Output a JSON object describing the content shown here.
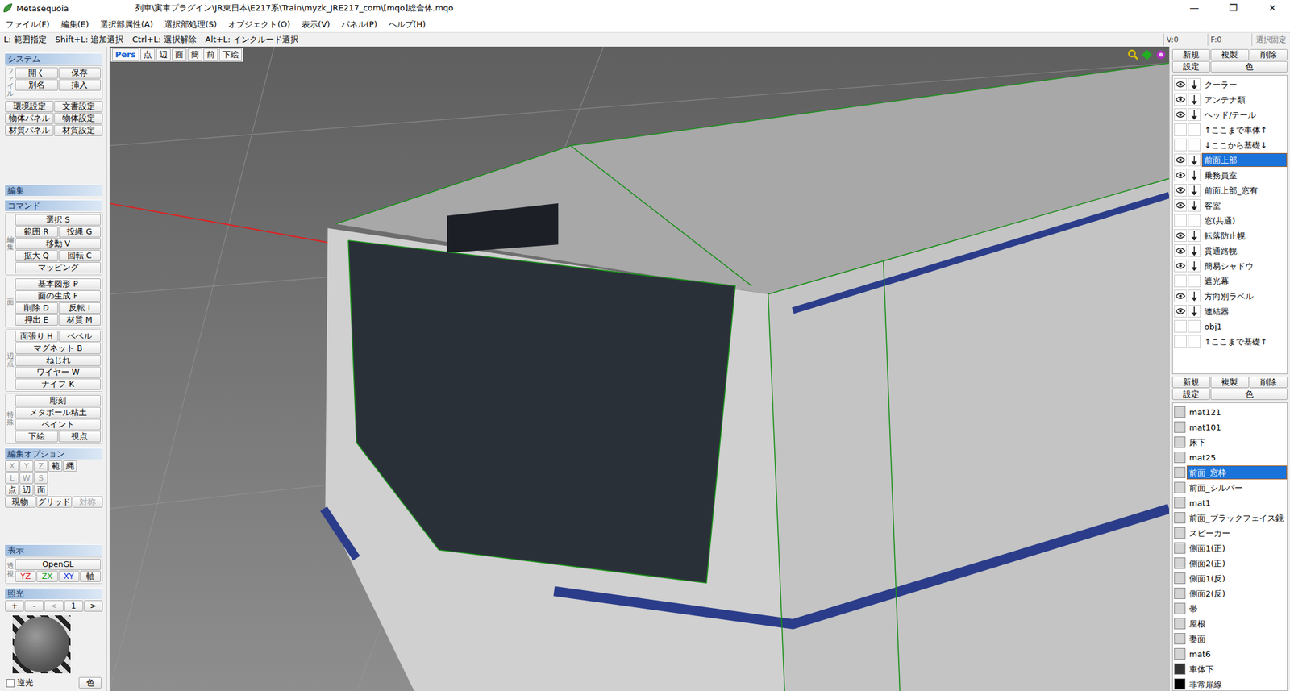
{
  "window": {
    "app": "Metasequoia",
    "path": "列車\\実車プラグイン\\JR東日本\\E217系\\Train\\myzk_JRE217_com\\[mqo]総合体.mqo",
    "controls": [
      "—",
      "❐",
      "✕"
    ]
  },
  "menu": [
    "ファイル(F)",
    "編集(E)",
    "選択部属性(A)",
    "選択部処理(S)",
    "オブジェクト(O)",
    "表示(V)",
    "パネル(P)",
    "ヘルプ(H)"
  ],
  "hint_bar": {
    "hints": [
      "L: 範囲指定",
      "Shift+L: 追加選択",
      "Ctrl+L: 選択解除",
      "Alt+L: インクルード選択"
    ],
    "counters": [
      "V:0",
      "F:0"
    ],
    "lock_button": "選択固定"
  },
  "left_panel": {
    "system": {
      "header": "システム",
      "group_label": "ファイル",
      "file_rows": [
        [
          "開く",
          "保存"
        ],
        [
          "別名",
          "挿入"
        ]
      ],
      "rows": [
        [
          "環境設定",
          "文書設定"
        ],
        [
          "物体パネル",
          "物体設定"
        ],
        [
          "材質パネル",
          "材質設定"
        ]
      ]
    },
    "edit_header": "編集",
    "command": {
      "header": "コマンド",
      "groups": [
        {
          "label": "編集",
          "rows": [
            [
              "選択 S"
            ],
            [
              "範囲 R",
              "投縄 G"
            ],
            [
              "移動 V"
            ],
            [
              "拡大 Q",
              "回転 C"
            ],
            [
              "マッピング"
            ]
          ]
        },
        {
          "label": "面",
          "rows": [
            [
              "基本図形 P"
            ],
            [
              "面の生成 F"
            ],
            [
              "削除 D",
              "反転 I"
            ],
            [
              "押出 E",
              "材質 M"
            ]
          ]
        },
        {
          "label": "辺・点",
          "rows": [
            [
              "面張り H",
              "ベベル"
            ],
            [
              "マグネット B"
            ],
            [
              "ねじれ"
            ],
            [
              "ワイヤー W"
            ],
            [
              "ナイフ K"
            ]
          ]
        },
        {
          "label": "特殊",
          "rows": [
            [
              "彫刻"
            ],
            [
              "メタボール粘土"
            ],
            [
              "ペイント"
            ],
            [
              "下絵",
              "視点"
            ]
          ]
        }
      ]
    },
    "edit_options": {
      "header": "編集オプション",
      "rows": [
        [
          {
            "label": "X",
            "enabled": false
          },
          {
            "label": "Y",
            "enabled": false
          },
          {
            "label": "Z",
            "enabled": false
          },
          {
            "label": "範",
            "enabled": true
          },
          {
            "label": "縄",
            "enabled": true
          }
        ],
        [
          {
            "label": "L",
            "enabled": false
          },
          {
            "label": "W",
            "enabled": false
          },
          {
            "label": "S",
            "enabled": false
          }
        ],
        [
          {
            "label": "点",
            "enabled": true
          },
          {
            "label": "辺",
            "enabled": true
          },
          {
            "label": "面",
            "enabled": true
          }
        ],
        [
          {
            "label": "現物",
            "enabled": true
          },
          {
            "label": "グリッド",
            "enabled": true
          },
          {
            "label": "対称",
            "enabled": false
          }
        ]
      ]
    },
    "display": {
      "header": "表示",
      "group_label": "透視",
      "render_button": "OpenGL",
      "axes": [
        {
          "label": "YZ",
          "color": "#e01010"
        },
        {
          "label": "ZX",
          "color": "#10a010"
        },
        {
          "label": "XY",
          "color": "#1030e0"
        },
        {
          "label": "軸",
          "color": "#000000"
        }
      ]
    },
    "lighting": {
      "header": "照光",
      "controls": [
        {
          "label": "+",
          "enabled": true
        },
        {
          "label": "-",
          "enabled": true
        },
        {
          "label": "<",
          "enabled": false
        },
        {
          "label": "1",
          "enabled": true
        },
        {
          "label": ">",
          "enabled": true
        }
      ],
      "backlight": {
        "label": "逆光",
        "checked": false
      },
      "color_button": "色"
    }
  },
  "viewport": {
    "toolbar": [
      {
        "label": "Pers",
        "selected": true
      },
      {
        "label": "点",
        "selected": false
      },
      {
        "label": "辺",
        "selected": false
      },
      {
        "label": "面",
        "selected": false
      },
      {
        "label": "簡",
        "selected": false
      },
      {
        "label": "前",
        "selected": false
      },
      {
        "label": "下絵",
        "selected": false
      }
    ]
  },
  "object_panel": {
    "buttons": [
      "新規",
      "複製",
      "削除"
    ],
    "buttons2": [
      "設定",
      "色"
    ],
    "items": [
      {
        "name": "クーラー",
        "visible": true,
        "editable": true,
        "selected": false
      },
      {
        "name": "アンテナ類",
        "visible": true,
        "editable": true,
        "selected": false
      },
      {
        "name": "ヘッド/テール",
        "visible": true,
        "editable": true,
        "selected": false
      },
      {
        "name": "↑ここまで車体↑",
        "visible": false,
        "editable": false,
        "selected": false
      },
      {
        "name": "↓ここから基礎↓",
        "visible": false,
        "editable": false,
        "selected": false
      },
      {
        "name": "前面上部",
        "visible": true,
        "editable": true,
        "selected": true
      },
      {
        "name": "乗務員室",
        "visible": true,
        "editable": true,
        "selected": false
      },
      {
        "name": "前面上部_窓有",
        "visible": true,
        "editable": true,
        "selected": false
      },
      {
        "name": "客室",
        "visible": true,
        "editable": true,
        "selected": false
      },
      {
        "name": "窓(共通)",
        "visible": false,
        "editable": false,
        "selected": false
      },
      {
        "name": "転落防止幌",
        "visible": true,
        "editable": true,
        "selected": false
      },
      {
        "name": "貫通路幌",
        "visible": true,
        "editable": true,
        "selected": false
      },
      {
        "name": "簡易シャドウ",
        "visible": true,
        "editable": true,
        "selected": false
      },
      {
        "name": "遮光幕",
        "visible": false,
        "editable": false,
        "selected": false
      },
      {
        "name": "方向別ラベル",
        "visible": true,
        "editable": true,
        "selected": false
      },
      {
        "name": "連結器",
        "visible": true,
        "editable": true,
        "selected": false
      },
      {
        "name": "obj1",
        "visible": false,
        "editable": false,
        "selected": false
      },
      {
        "name": "↑ここまで基礎↑",
        "visible": false,
        "editable": false,
        "selected": false
      }
    ]
  },
  "material_panel": {
    "buttons": [
      "新規",
      "複製",
      "削除"
    ],
    "buttons2": [
      "設定",
      "色"
    ],
    "items": [
      {
        "name": "mat121",
        "color": "#d4d4d4",
        "selected": false
      },
      {
        "name": "mat101",
        "color": "#d4d4d4",
        "selected": false
      },
      {
        "name": "床下",
        "color": "#d4d4d4",
        "selected": false
      },
      {
        "name": "mat25",
        "color": "#d4d4d4",
        "selected": false
      },
      {
        "name": "前面_窓枠",
        "color": "#d4d4d4",
        "selected": true
      },
      {
        "name": "前面_シルバー",
        "color": "#d4d4d4",
        "selected": false
      },
      {
        "name": "mat1",
        "color": "#d4d4d4",
        "selected": false
      },
      {
        "name": "前面_ブラックフェイス鏡",
        "color": "#d4d4d4",
        "selected": false
      },
      {
        "name": "スピーカー",
        "color": "#d4d4d4",
        "selected": false
      },
      {
        "name": "側面1(正)",
        "color": "#d4d4d4",
        "selected": false
      },
      {
        "name": "側面2(正)",
        "color": "#d4d4d4",
        "selected": false
      },
      {
        "name": "側面1(反)",
        "color": "#d4d4d4",
        "selected": false
      },
      {
        "name": "側面2(反)",
        "color": "#d4d4d4",
        "selected": false
      },
      {
        "name": "帯",
        "color": "#d4d4d4",
        "selected": false
      },
      {
        "name": "屋根",
        "color": "#d4d4d4",
        "selected": false
      },
      {
        "name": "妻面",
        "color": "#d4d4d4",
        "selected": false
      },
      {
        "name": "mat6",
        "color": "#d4d4d4",
        "selected": false
      },
      {
        "name": "車体下",
        "color": "#333333",
        "selected": false
      },
      {
        "name": "非常扉線",
        "color": "#000000",
        "selected": false
      }
    ]
  }
}
